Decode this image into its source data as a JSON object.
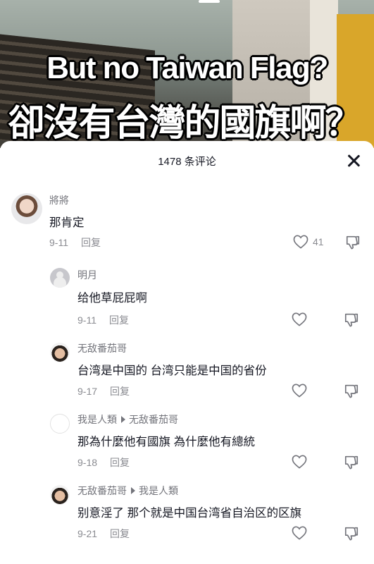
{
  "video": {
    "caption_en": "But no Taiwan Flag?",
    "caption_zh": "卻沒有台灣的國旗啊？"
  },
  "comments_panel": {
    "title": "1478 条评论",
    "reply_label": "回复",
    "comments": [
      {
        "user": "將將",
        "text": "那肯定",
        "date": "9-11",
        "likes": "41"
      },
      {
        "user": "明月",
        "text": "给他草屁屁啊",
        "date": "9-11"
      },
      {
        "user": "无敌番茄哥",
        "text": "台湾是中国的 台湾只能是中国的省份",
        "date": "9-17"
      },
      {
        "user": "我是人類",
        "reply_to": "无敌番茄哥",
        "text": "那為什麼他有國旗 為什麼他有總統",
        "date": "9-18"
      },
      {
        "user": "无敌番茄哥",
        "reply_to": "我是人類",
        "text": "别意淫了 那个就是中国台湾省自治区的区旗",
        "date": "9-21"
      }
    ]
  },
  "icons": {
    "like": "heart-outline-icon",
    "dislike": "thumbs-down-outline-icon",
    "close": "close-icon"
  }
}
